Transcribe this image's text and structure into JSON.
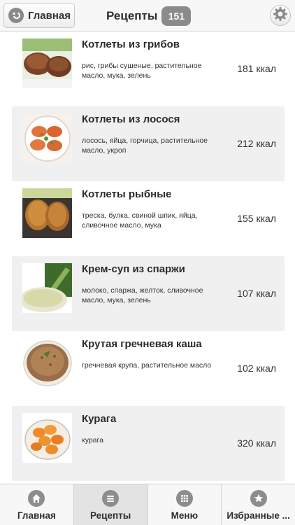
{
  "header": {
    "back_label": "Главная",
    "title": "Рецепты",
    "count": "151"
  },
  "recipes": [
    {
      "title": "Котлеты из грибов",
      "ingredients": "рис, грибы сушеные, растительное масло, мука, зелень",
      "kcal": "181 ккал"
    },
    {
      "title": "Котлеты из лосося",
      "ingredients": "лосось, яйца, горчица, растительное масло, укроп",
      "kcal": "212 ккал"
    },
    {
      "title": "Котлеты рыбные",
      "ingredients": "треска, булка, свиной шпик, яйца, сливочное масло, мука",
      "kcal": "155 ккал"
    },
    {
      "title": "Крем-суп из спаржи",
      "ingredients": "молоко, спаржа, желток, сливочное масло, мука, зелень",
      "kcal": "107 ккал"
    },
    {
      "title": "Крутая гречневая каша",
      "ingredients": "гречневая крупа, растительное масло",
      "kcal": "102 ккал"
    },
    {
      "title": "Курага",
      "ingredients": "курага",
      "kcal": "320 ккал"
    }
  ],
  "tabs": [
    {
      "label": "Главная",
      "icon": "home-icon",
      "active": false
    },
    {
      "label": "Рецепты",
      "icon": "list-icon",
      "active": true
    },
    {
      "label": "Меню",
      "icon": "grid-icon",
      "active": false
    },
    {
      "label": "Избранные ...",
      "icon": "star-icon",
      "active": false
    }
  ]
}
